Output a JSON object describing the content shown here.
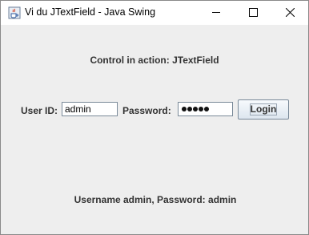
{
  "window": {
    "title": "Vi du JTextField - Java Swing",
    "icon": "java-cup-icon",
    "controls": [
      "minimize-icon",
      "maximize-icon",
      "close-icon"
    ]
  },
  "main": {
    "heading": "Control in action: JTextField",
    "userid_label": "User ID:",
    "userid_value": "admin",
    "password_label": "Password:",
    "password_mask": "●●●●●",
    "login_label": "Login",
    "footer": "Username admin, Password: admin"
  },
  "colors": {
    "window_bg": "#eeeeee",
    "titlebar_bg": "#ffffff",
    "label_text": "#333333",
    "field_border": "#7a8a99"
  }
}
